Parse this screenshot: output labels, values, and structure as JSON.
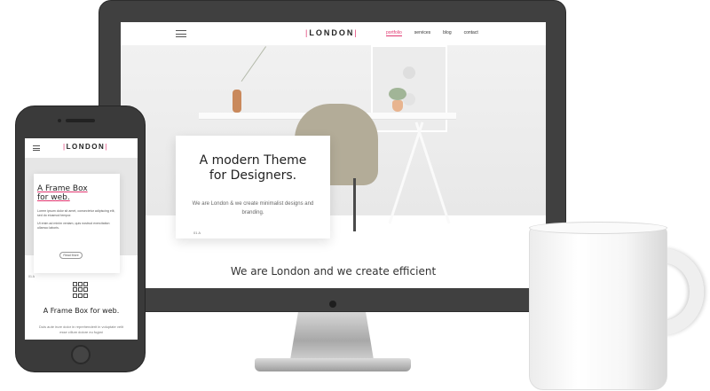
{
  "desktop": {
    "logo": "LONDON",
    "nav": [
      "portfolio",
      "services",
      "blog",
      "contact"
    ],
    "hero_title_line1": "A modern Theme",
    "hero_title_line2": "for Designers.",
    "hero_text": "We are London & we create minimalist designs and branding.",
    "hero_tag": "01 A",
    "tagline": "We are London and we create efficient"
  },
  "mobile": {
    "logo": "LONDON",
    "card_title_line1": "A Frame Box",
    "card_title_line2": "for web.",
    "card_text_1": "Lorem ipsum dolor sit amet, consectetur adipiscing elit, sed do eiusmod tempor.",
    "card_text_2": "Ut enim ad minim veniam, quis nostrud exercitation ullamco laboris.",
    "button": "Read More",
    "tag": "01 A",
    "section_title": "A Frame Box for web.",
    "section_text": "Duis aute irure dolor in reprehenderit in voluptate velit esse cillum dolore eu fugiat"
  },
  "colors": {
    "accent": "#e0366f",
    "device_frame": "#404040"
  }
}
